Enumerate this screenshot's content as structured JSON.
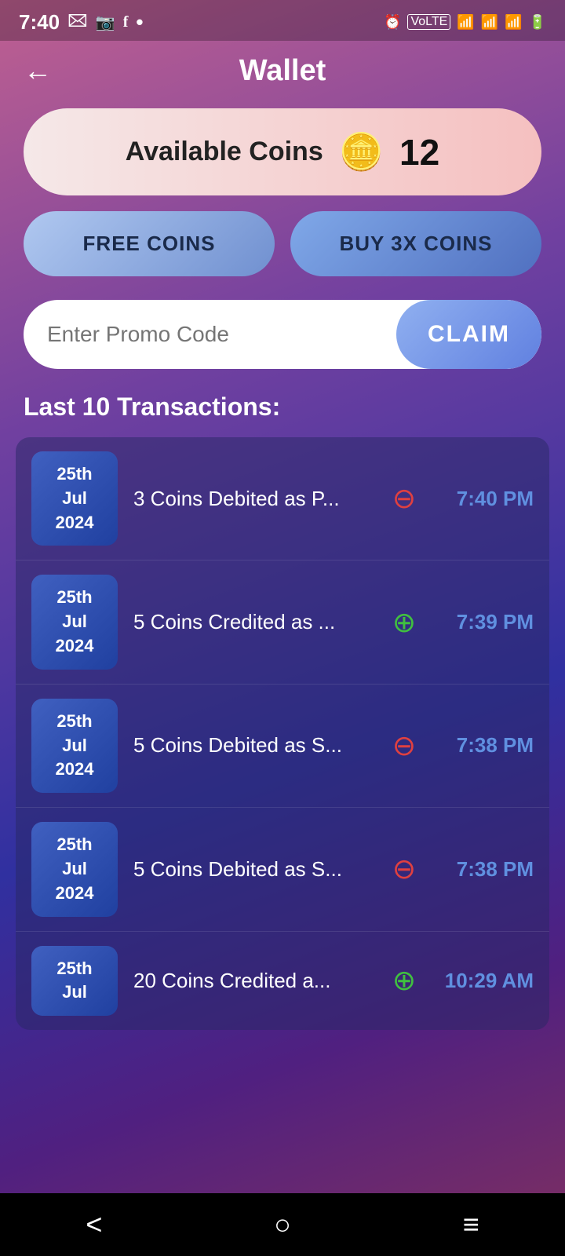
{
  "statusBar": {
    "time": "7:40",
    "icons": [
      "📧",
      "📷",
      "ⓕ",
      "•"
    ],
    "rightIcons": "⏰ VoLTE WiFi Signal Battery"
  },
  "header": {
    "backLabel": "←",
    "title": "Wallet"
  },
  "coinsCard": {
    "label": "Available Coins",
    "coinEmoji": "🪙",
    "value": "12"
  },
  "buttons": {
    "freeCoins": "FREE COINS",
    "buyCoins": "BUY 3X COINS"
  },
  "promoCode": {
    "placeholder": "Enter Promo Code",
    "claimLabel": "CLAIM"
  },
  "transactionsTitle": "Last 10 Transactions:",
  "transactions": [
    {
      "date": "25th\nJul\n2024",
      "description": "3 Coins Debited as P...",
      "type": "debit",
      "time": "7:40 PM"
    },
    {
      "date": "25th\nJul\n2024",
      "description": "5 Coins Credited as ...",
      "type": "credit",
      "time": "7:39 PM"
    },
    {
      "date": "25th\nJul\n2024",
      "description": "5 Coins Debited as S...",
      "type": "debit",
      "time": "7:38 PM"
    },
    {
      "date": "25th\nJul\n2024",
      "description": "5 Coins Debited as S...",
      "type": "debit",
      "time": "7:38 PM"
    },
    {
      "date": "25th\nJul",
      "description": "20 Coins Credited a...",
      "type": "credit",
      "time": "10:29 AM"
    }
  ],
  "bottomNav": {
    "back": "<",
    "home": "○",
    "menu": "≡"
  }
}
